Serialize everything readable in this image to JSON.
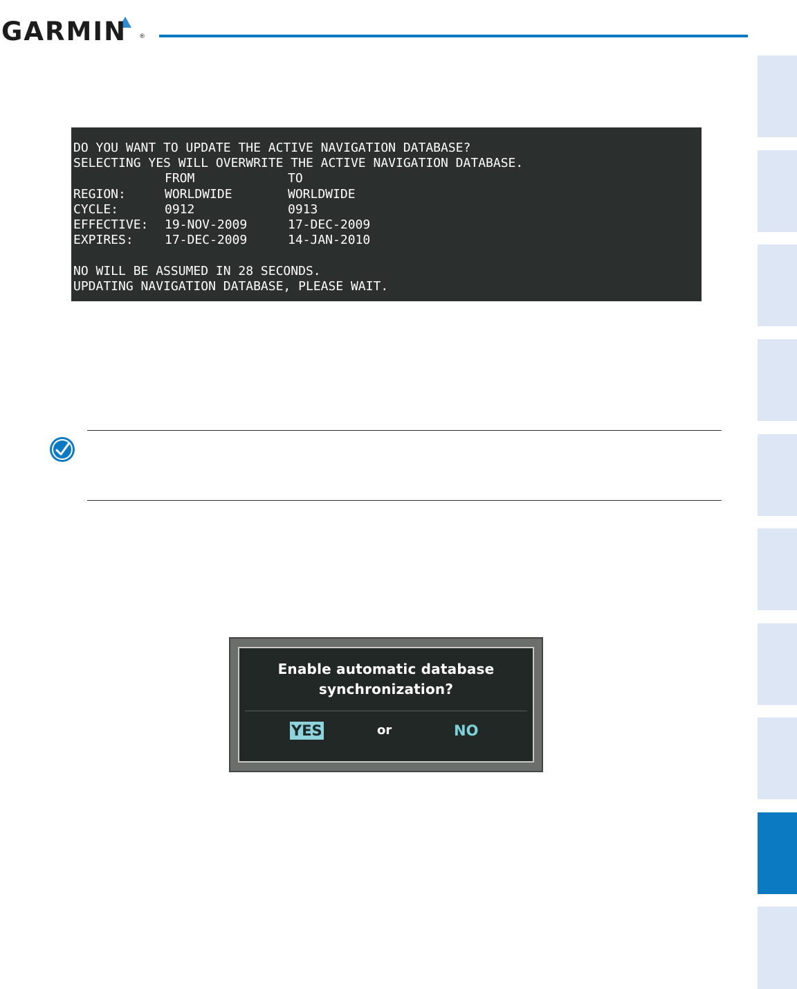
{
  "header": {
    "brand": "GARMIN",
    "reg_mark": "®"
  },
  "colors": {
    "brand_blue": "#0b7ac3",
    "tab_inactive": "#dde6f5",
    "terminal_bg": "#2b2f2d",
    "yes_highlight": "#8fd3dc",
    "no_text": "#7fd1d9"
  },
  "side_tabs": {
    "count": 10,
    "active_index": 8
  },
  "terminal": {
    "line1": "DO YOU WANT TO UPDATE THE ACTIVE NAVIGATION DATABASE?",
    "line2": "SELECTING YES WILL OVERWRITE THE ACTIVE NAVIGATION DATABASE.",
    "header_from": "FROM",
    "header_to": "TO",
    "rows": [
      {
        "label": "REGION:",
        "from": "WORLDWIDE",
        "to": "WORLDWIDE"
      },
      {
        "label": "CYCLE:",
        "from": "0912",
        "to": "0913"
      },
      {
        "label": "EFFECTIVE:",
        "from": "19-NOV-2009",
        "to": "17-DEC-2009"
      },
      {
        "label": "EXPIRES:",
        "from": "17-DEC-2009",
        "to": "14-JAN-2010"
      }
    ],
    "line_timeout": "NO WILL BE ASSUMED IN 28 SECONDS.",
    "line_status": "UPDATING NAVIGATION DATABASE, PLEASE WAIT."
  },
  "note": {
    "icon": "checkmark-note-icon"
  },
  "dialog": {
    "title_line1": "Enable automatic database",
    "title_line2": "synchronization?",
    "yes": "YES",
    "or": "or",
    "no": "NO"
  }
}
